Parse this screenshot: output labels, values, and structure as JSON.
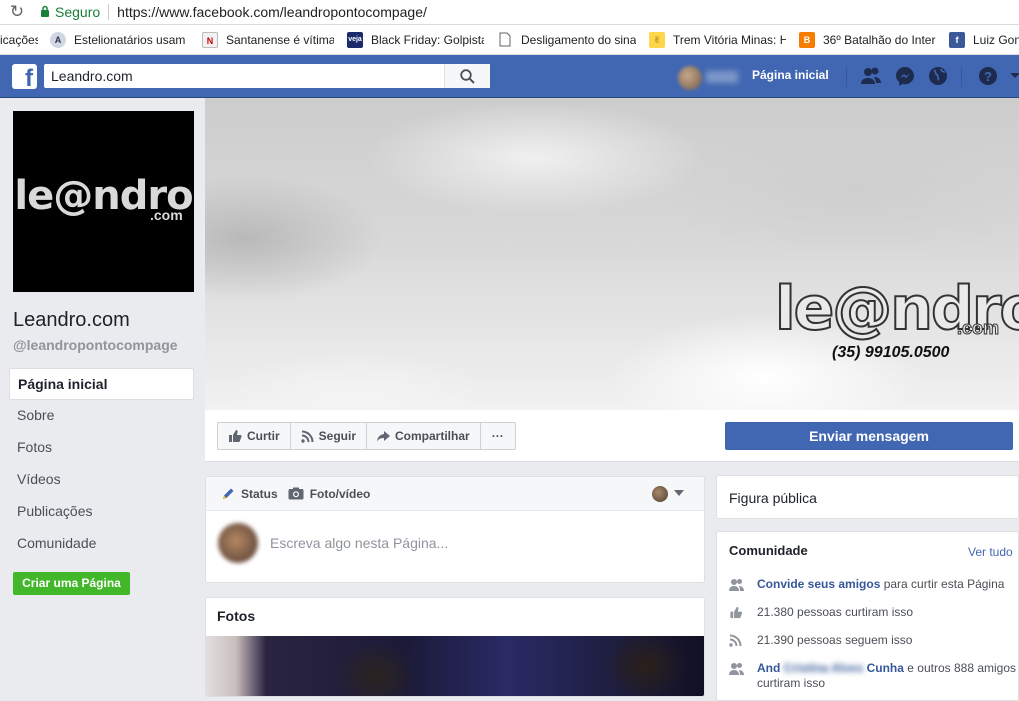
{
  "browser": {
    "secure_label": "Seguro",
    "url": "https://www.facebook.com/leandropontocompage/",
    "bookmarks": [
      {
        "label": "icações",
        "icon": "none"
      },
      {
        "label": "Estelionatários usam",
        "icon": "site-logo-icon"
      },
      {
        "label": "Santanense é vítima d",
        "icon": "news-icon"
      },
      {
        "label": "Black Friday: Golpista",
        "icon": "veja-icon"
      },
      {
        "label": "Desligamento do sina",
        "icon": "document-icon"
      },
      {
        "label": "Trem Vitória Minas: H",
        "icon": "hand-icon"
      },
      {
        "label": "36º Batalhão do Inter",
        "icon": "blogger-icon"
      },
      {
        "label": "Luiz Gon",
        "icon": "facebook-icon"
      }
    ]
  },
  "fbbar": {
    "search_value": "Leandro.com",
    "home_label": "Página inicial",
    "brand_color": "#4267b2"
  },
  "page": {
    "name": "Leandro.com",
    "username": "@leandropontocompage",
    "profile_logo": "le@ndro",
    "profile_logo_sub": ".com",
    "cover_logo": "le@ndro",
    "cover_logo_sub": ".com",
    "cover_phone": "(35) 99105.0500"
  },
  "nav": [
    "Página inicial",
    "Sobre",
    "Fotos",
    "Vídeos",
    "Publicações",
    "Comunidade"
  ],
  "create_page": "Criar uma Página",
  "actions": {
    "like": "Curtir",
    "follow": "Seguir",
    "share": "Compartilhar",
    "more": "···",
    "send_message": "Enviar mensagem"
  },
  "composer": {
    "tab_status": "Status",
    "tab_photo": "Foto/vídeo",
    "placeholder": "Escreva algo nesta Página..."
  },
  "fotos": {
    "title": "Fotos"
  },
  "right": {
    "category": "Figura pública",
    "community_title": "Comunidade",
    "see_all": "Ver tudo",
    "invite_link": "Convide seus amigos",
    "invite_rest": " para curtir esta Página",
    "likes": "21.380 pessoas curtiram isso",
    "follows": "21.390 pessoas seguem isso",
    "friends_name_a": "And",
    "friends_name_blur": "Cristina Alves",
    "friends_name_b": "Cunha",
    "friends_rest": " e outros 888 amigos curtiram isso"
  }
}
